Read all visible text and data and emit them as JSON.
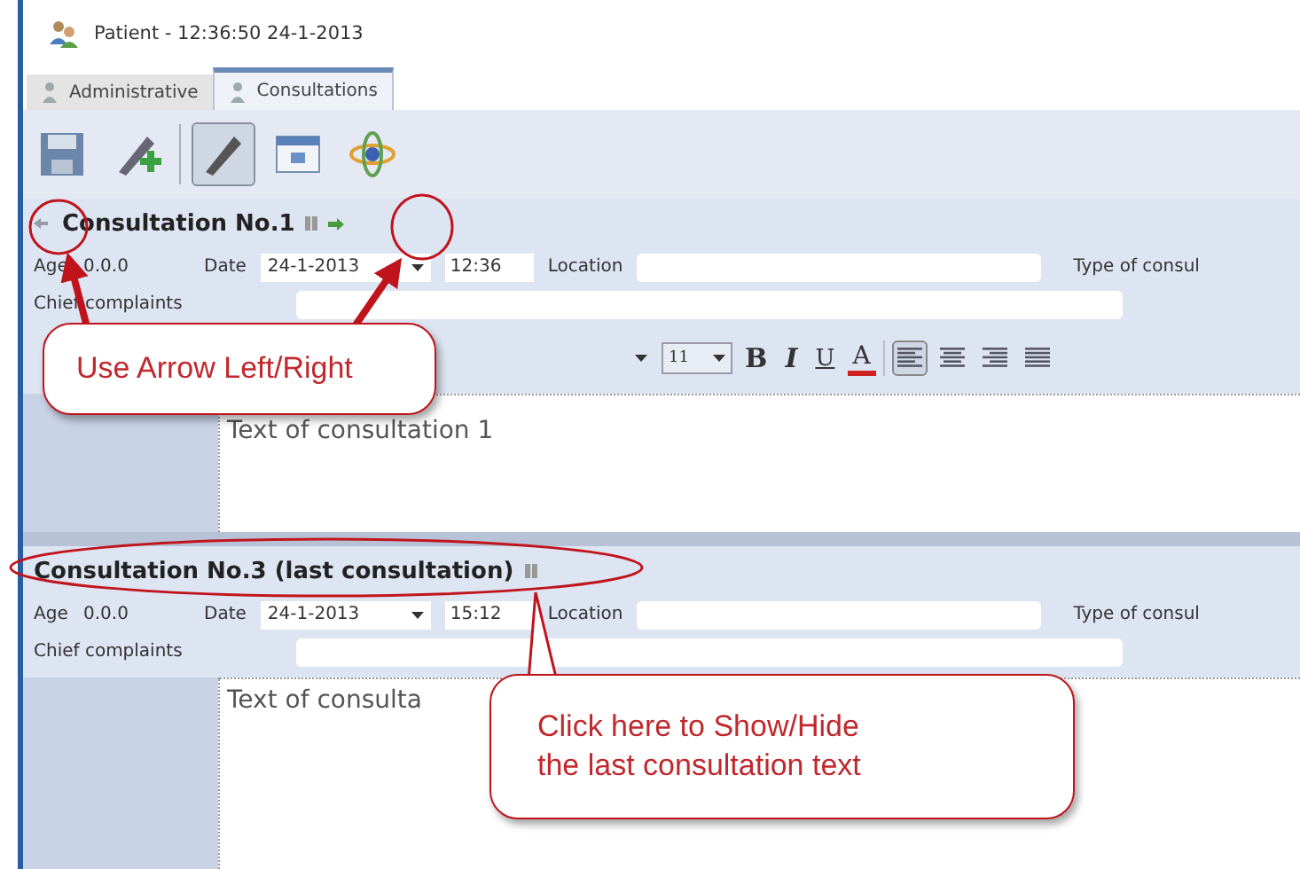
{
  "window": {
    "title": "Patient - 12:36:50 24-1-2013"
  },
  "tabs": [
    {
      "label": "Administrative",
      "selected": false
    },
    {
      "label": "Consultations",
      "selected": true
    }
  ],
  "toolbar": [
    {
      "kind": "save",
      "pressed": false
    },
    {
      "kind": "add",
      "pressed": false
    },
    {
      "kind": "edit",
      "pressed": true
    },
    {
      "kind": "calendar",
      "pressed": false
    },
    {
      "kind": "atom",
      "pressed": false
    }
  ],
  "consultations": [
    {
      "title": "Consultation No.1",
      "nav": true,
      "age_label": "Age",
      "age": "0.0.0",
      "date_label": "Date",
      "date": "24-1-2013",
      "time": "12:36",
      "location_label": "Location",
      "type_label": "Type of consul",
      "complaints_label": "Chief complaints",
      "format_bar": {
        "font_size": "11",
        "styles": [
          {
            "label": "B",
            "kind": "bold"
          },
          {
            "label": "I",
            "kind": "italic"
          },
          {
            "label": "U",
            "kind": "underline"
          },
          {
            "label": "A",
            "kind": "color"
          }
        ],
        "align": [
          {
            "kind": "left",
            "selected": true
          },
          {
            "kind": "center",
            "selected": false
          },
          {
            "kind": "right",
            "selected": false
          },
          {
            "kind": "justify",
            "selected": false
          }
        ]
      },
      "text": "Text of consultation 1"
    },
    {
      "title": "Consultation No.3 (last consultation)",
      "nav": false,
      "age_label": "Age",
      "age": "0.0.0",
      "date_label": "Date",
      "date": "24-1-2013",
      "time": "15:12",
      "location_label": "Location",
      "type_label": "Type of consul",
      "complaints_label": "Chief complaints",
      "text": "Text of consulta"
    }
  ],
  "callouts": [
    {
      "text": "Use Arrow Left/Right"
    },
    {
      "text": "Click here to Show/Hide the last consultation text"
    }
  ]
}
